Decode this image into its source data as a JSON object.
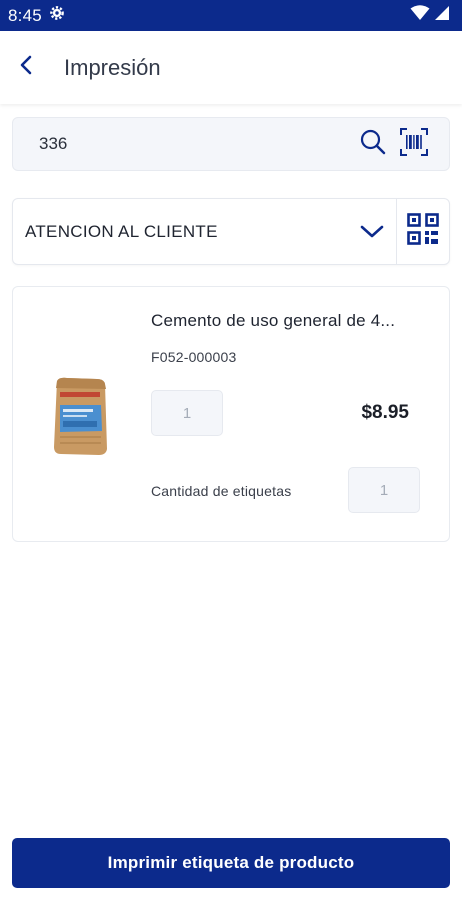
{
  "status_bar": {
    "time": "8:45",
    "background_color": "#0c2a8c",
    "icons": [
      "settings-gear-icon",
      "wifi-icon",
      "cell-signal-icon"
    ]
  },
  "header": {
    "title": "Impresión",
    "back_icon": "chevron-left-icon"
  },
  "search": {
    "value": "336",
    "icons": [
      "search-icon",
      "barcode-scan-icon"
    ]
  },
  "location_select": {
    "selected": "ATENCION AL CLIENTE",
    "icons": [
      "chevron-down-icon",
      "qr-code-icon"
    ]
  },
  "product": {
    "name": "Cemento de uso general de 4...",
    "code": "F052-000003",
    "quantity": "1",
    "price": "$8.95",
    "labels_label": "Cantidad de etiquetas",
    "labels_count": "1",
    "image": "cement-bag-image"
  },
  "footer": {
    "print_button_label": "Imprimir etiqueta de producto"
  },
  "colors": {
    "primary": "#0c2a8c",
    "input_background": "#f4f6fa",
    "border": "#e5e8ee"
  }
}
